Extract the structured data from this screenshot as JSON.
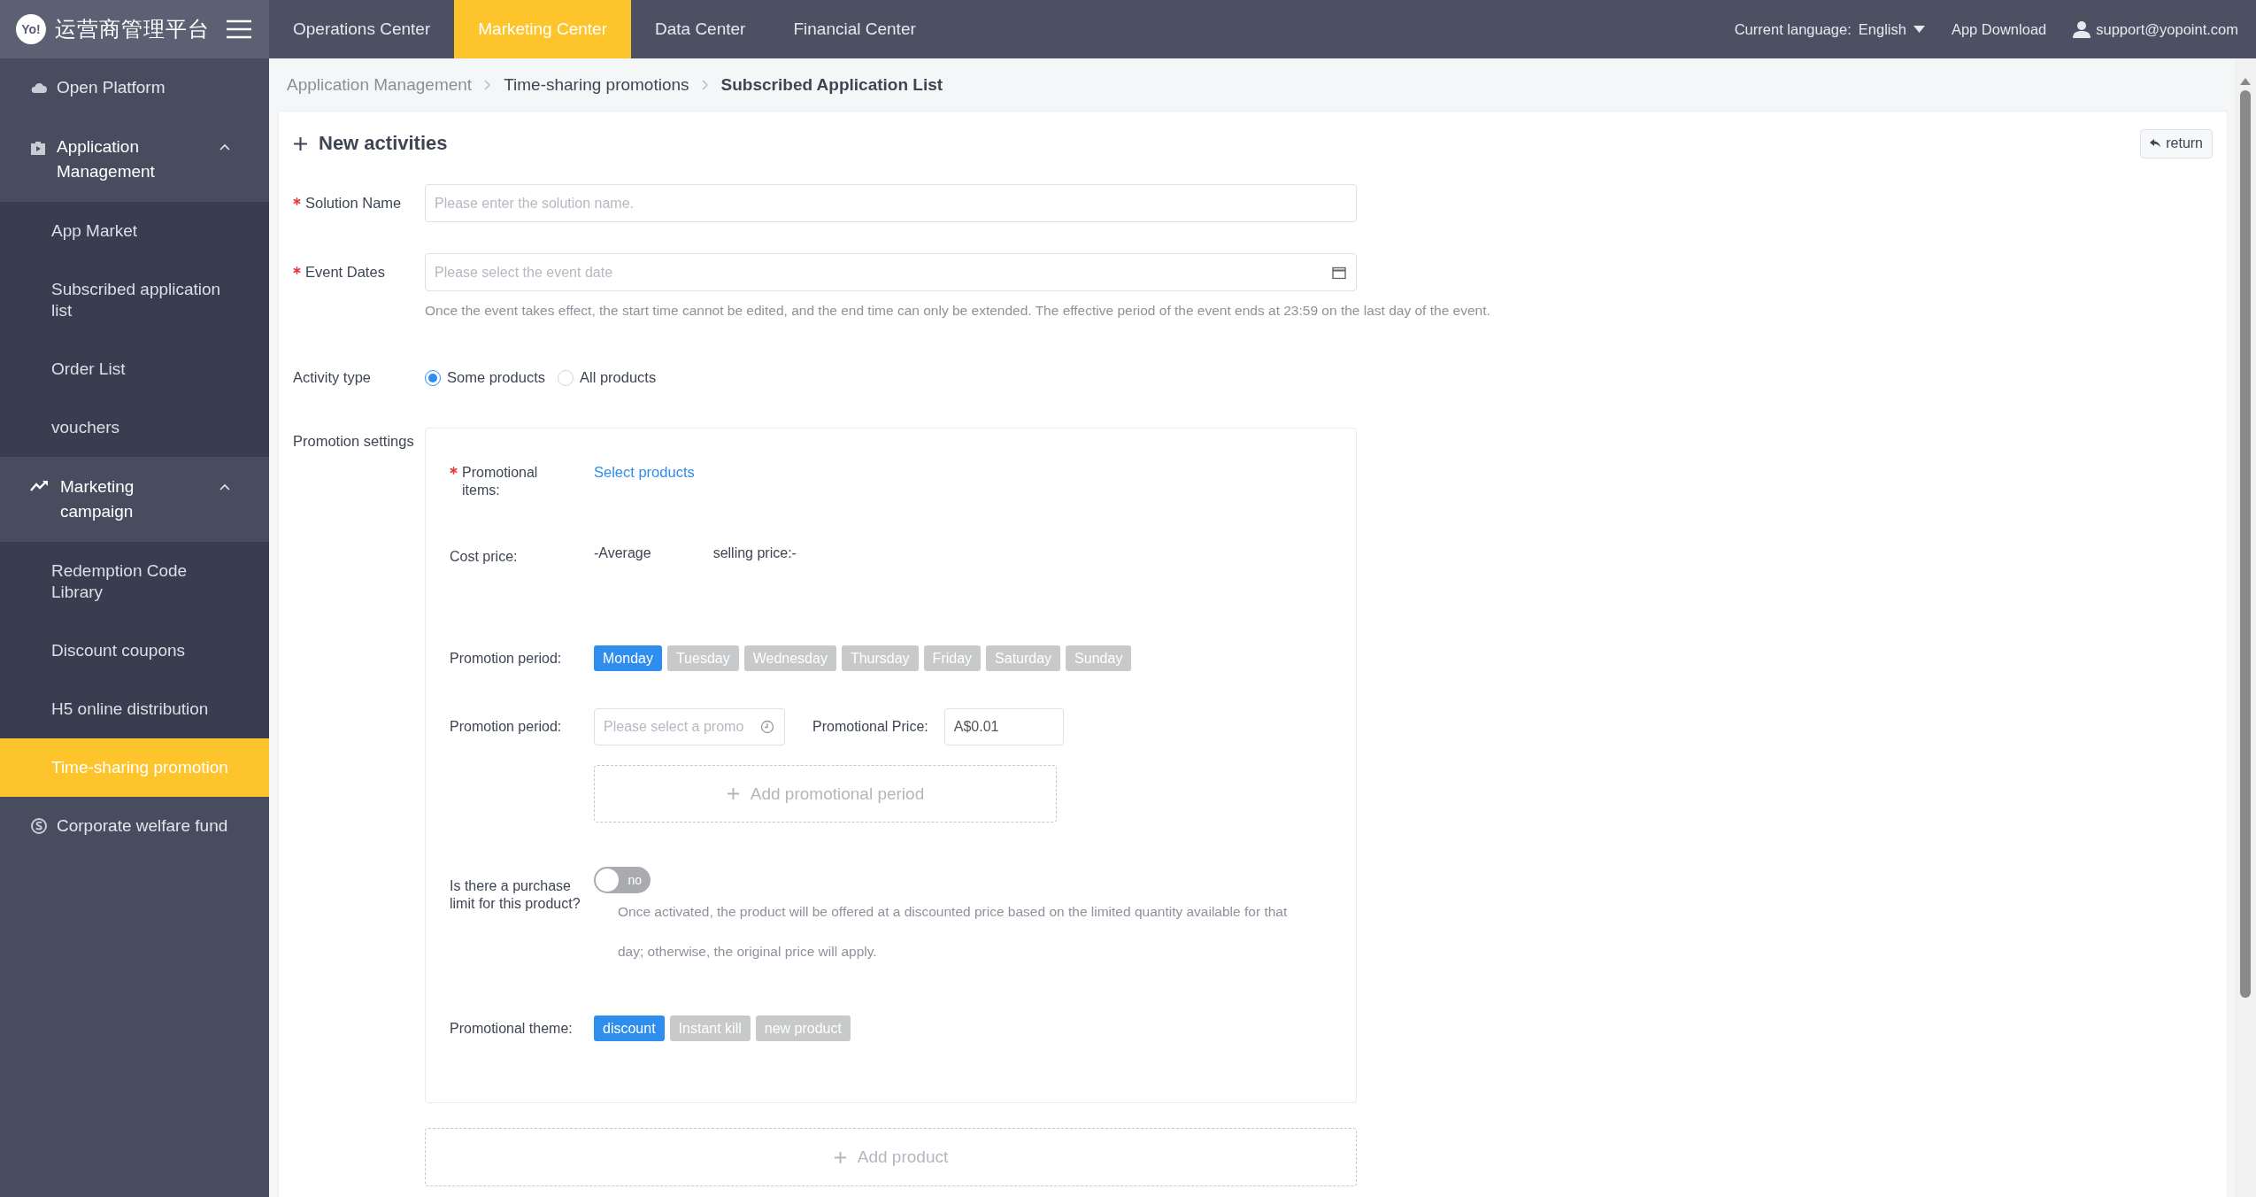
{
  "header": {
    "logo_mark": "Yo!",
    "logo_text": "运营商管理平台",
    "nav": [
      {
        "label": "Operations Center",
        "selected": false
      },
      {
        "label": "Marketing Center",
        "selected": true
      },
      {
        "label": "Data Center",
        "selected": false
      },
      {
        "label": "Financial Center",
        "selected": false
      }
    ],
    "language_label": "Current language:",
    "language": "English",
    "app_download": "App Download",
    "user": "support@yopoint.com"
  },
  "sidebar": {
    "items": [
      {
        "kind": "link",
        "label": "Open Platform",
        "selected": false
      },
      {
        "kind": "group",
        "label": "Application Management",
        "expanded": true,
        "children": [
          {
            "label": "App Market",
            "selected": false
          },
          {
            "label": "Subscribed application list",
            "selected": false
          },
          {
            "label": "Order List",
            "selected": false
          },
          {
            "label": "vouchers",
            "selected": false
          }
        ]
      },
      {
        "kind": "group",
        "label": "Marketing campaign",
        "expanded": true,
        "children": [
          {
            "label": "Redemption Code Library",
            "selected": false
          },
          {
            "label": "Discount coupons",
            "selected": false
          },
          {
            "label": "H5 online distribution",
            "selected": false
          },
          {
            "label": "Time-sharing promotion",
            "selected": true
          }
        ]
      },
      {
        "kind": "link",
        "label": "Corporate welfare fund",
        "selected": false
      }
    ]
  },
  "breadcrumb": [
    {
      "label": "Application Management",
      "current": false
    },
    {
      "label": "Time-sharing promotions",
      "current": false
    },
    {
      "label": "Subscribed Application List",
      "current": true
    }
  ],
  "form": {
    "title": "New activities",
    "return_button": "return",
    "solution_name": {
      "label": "Solution Name",
      "required": true,
      "placeholder": "Please enter the solution name."
    },
    "event_dates": {
      "label": "Event Dates",
      "required": true,
      "placeholder": "Please select the event date",
      "hint": "Once the event takes effect, the start time cannot be edited, and the end time can only be extended. The effective period of the event ends at 23:59 on the last day of the event."
    },
    "activity_type": {
      "label": "Activity type",
      "options": [
        {
          "label": "Some products",
          "selected": true
        },
        {
          "label": "All products",
          "selected": false
        }
      ]
    },
    "promotion_settings": {
      "label": "Promotion settings",
      "promotional_items": {
        "label": "Promotional items:",
        "required": true,
        "link": "Select products"
      },
      "cost_price": {
        "label": "Cost price:",
        "value": "-Average",
        "selling_price": "selling price:-"
      },
      "days": {
        "label": "Promotion period:",
        "options": [
          {
            "label": "Monday",
            "selected": true
          },
          {
            "label": "Tuesday",
            "selected": false
          },
          {
            "label": "Wednesday",
            "selected": false
          },
          {
            "label": "Thursday",
            "selected": false
          },
          {
            "label": "Friday",
            "selected": false
          },
          {
            "label": "Saturday",
            "selected": false
          },
          {
            "label": "Sunday",
            "selected": false
          }
        ]
      },
      "period": {
        "label": "Promotion period:",
        "placeholder": "Please select a promo",
        "price_label": "Promotional Price:",
        "price": "A$0.01"
      },
      "add_period": "Add promotional period",
      "purchase_limit": {
        "label": "Is there a purchase limit for this product?",
        "on": false,
        "toggle_text": "no",
        "hint": "Once activated, the product will be offered at a discounted price based on the limited quantity available for that day; otherwise, the original price will apply."
      },
      "theme": {
        "label": "Promotional theme:",
        "options": [
          {
            "label": "discount",
            "selected": true
          },
          {
            "label": "Instant kill",
            "selected": false
          },
          {
            "label": "new product",
            "selected": false
          }
        ]
      }
    },
    "add_product": "Add product"
  }
}
